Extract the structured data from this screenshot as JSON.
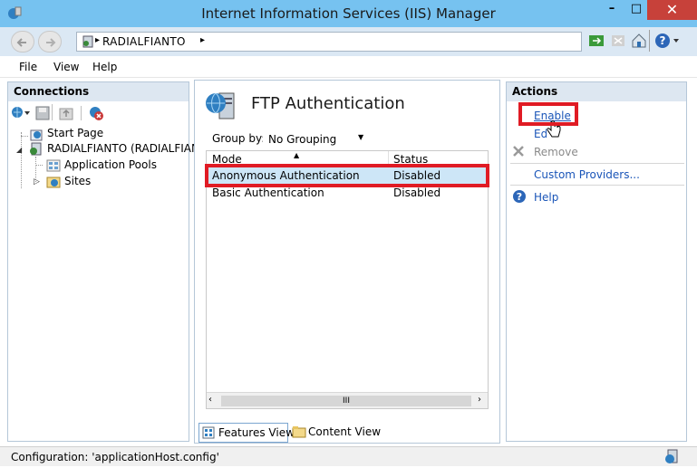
{
  "window": {
    "title": "Internet Information Services (IIS) Manager",
    "minimize": "–",
    "maximize": "□",
    "close": "✕"
  },
  "address": {
    "crumbs": [
      "RADIALFIANTO"
    ],
    "separator": "▸"
  },
  "menu": {
    "file": "File",
    "view": "View",
    "help": "Help"
  },
  "connections": {
    "header": "Connections",
    "tree": {
      "start_page": "Start Page",
      "server": "RADIALFIANTO (RADIALFIAN",
      "app_pools": "Application Pools",
      "sites": "Sites"
    }
  },
  "center": {
    "title": "FTP Authentication",
    "group_by_label": "Group by:",
    "group_by_value": "No Grouping",
    "columns": {
      "mode": "Mode",
      "status": "Status"
    },
    "rows": [
      {
        "mode": "Anonymous Authentication",
        "status": "Disabled"
      },
      {
        "mode": "Basic Authentication",
        "status": "Disabled"
      }
    ],
    "scroll_thumb": "III",
    "tabs": {
      "features": "Features View",
      "content": "Content View"
    }
  },
  "actions": {
    "header": "Actions",
    "enable": "Enable",
    "edit": "Edit...",
    "remove": "Remove",
    "custom_providers": "Custom Providers...",
    "help": "Help"
  },
  "status": {
    "text": "Configuration: 'applicationHost.config'"
  },
  "colors": {
    "titlebar": "#76c2f0",
    "highlight": "#e01b24",
    "link": "#1a55b8",
    "close": "#c7413a"
  }
}
